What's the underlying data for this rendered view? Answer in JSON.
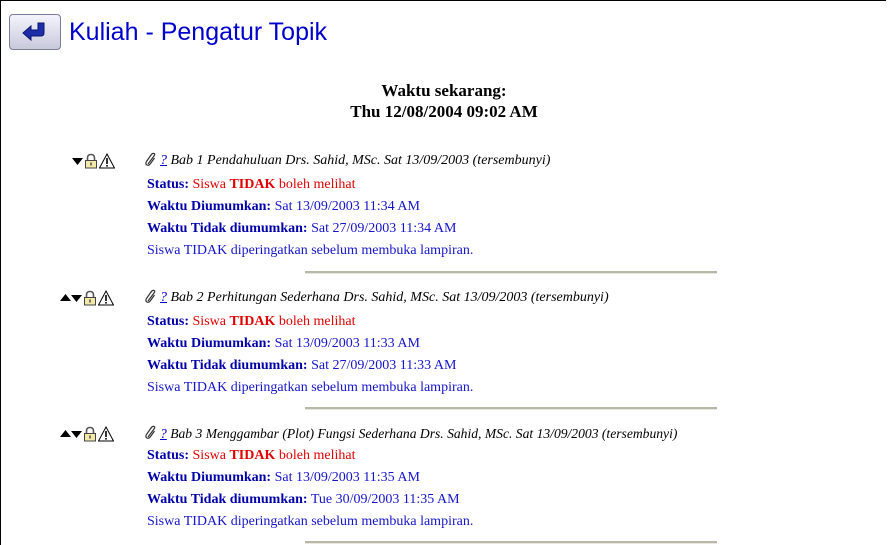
{
  "header": {
    "title": "Kuliah - Pengatur Topik",
    "back_icon": "return-arrow-icon"
  },
  "clock": {
    "label": "Waktu sekarang:",
    "value": "Thu 12/08/2004 09:02 AM"
  },
  "topics": [
    {
      "help": "?",
      "title": "Bab 1 Pendahuluan Drs. Sahid, MSc. Sat 13/09/2003 (tersembunyi)",
      "status_label": "Status:",
      "status_pre": "Siswa",
      "status_tidak": "TIDAK",
      "status_post": "boleh melihat",
      "announce_label": "Waktu Diumumkan:",
      "announce_value": "Sat 13/09/2003 11:34 AM",
      "unannounce_label": "Waktu Tidak diumumkan:",
      "unannounce_value": "Sat 27/09/2003 11:34 AM",
      "warning": "Siswa TIDAK diperingatkan sebelum membuka lampiran."
    },
    {
      "help": "?",
      "title": "Bab 2 Perhitungan Sederhana Drs. Sahid, MSc. Sat 13/09/2003 (tersembunyi)",
      "status_label": "Status:",
      "status_pre": "Siswa",
      "status_tidak": "TIDAK",
      "status_post": "boleh melihat",
      "announce_label": "Waktu Diumumkan:",
      "announce_value": "Sat 13/09/2003 11:33 AM",
      "unannounce_label": "Waktu Tidak diumumkan:",
      "unannounce_value": "Sat 27/09/2003 11:33 AM",
      "warning": "Siswa TIDAK diperingatkan sebelum membuka lampiran."
    },
    {
      "help": "?",
      "title": "Bab 3 Menggambar (Plot) Fungsi Sederhana Drs. Sahid, MSc. Sat 13/09/2003 (tersembunyi)",
      "status_label": "Status:",
      "status_pre": "Siswa",
      "status_tidak": "TIDAK",
      "status_post": "boleh melihat",
      "announce_label": "Waktu Diumumkan:",
      "announce_value": "Sat 13/09/2003 11:35 AM",
      "unannounce_label": "Waktu Tidak diumumkan:",
      "unannounce_value": "Tue 30/09/2003 11:35 AM",
      "warning": "Siswa TIDAK diperingatkan sebelum membuka lampiran."
    }
  ],
  "icons": {
    "move_up": "triangle-up-icon",
    "move_down": "triangle-down-icon",
    "lock": "padlock-icon",
    "warning": "warning-triangle-icon",
    "attachment": "paperclip-icon"
  },
  "colors": {
    "link_blue": "#0000cc",
    "info_blue": "#1515cc",
    "alert_red": "#e00000"
  }
}
